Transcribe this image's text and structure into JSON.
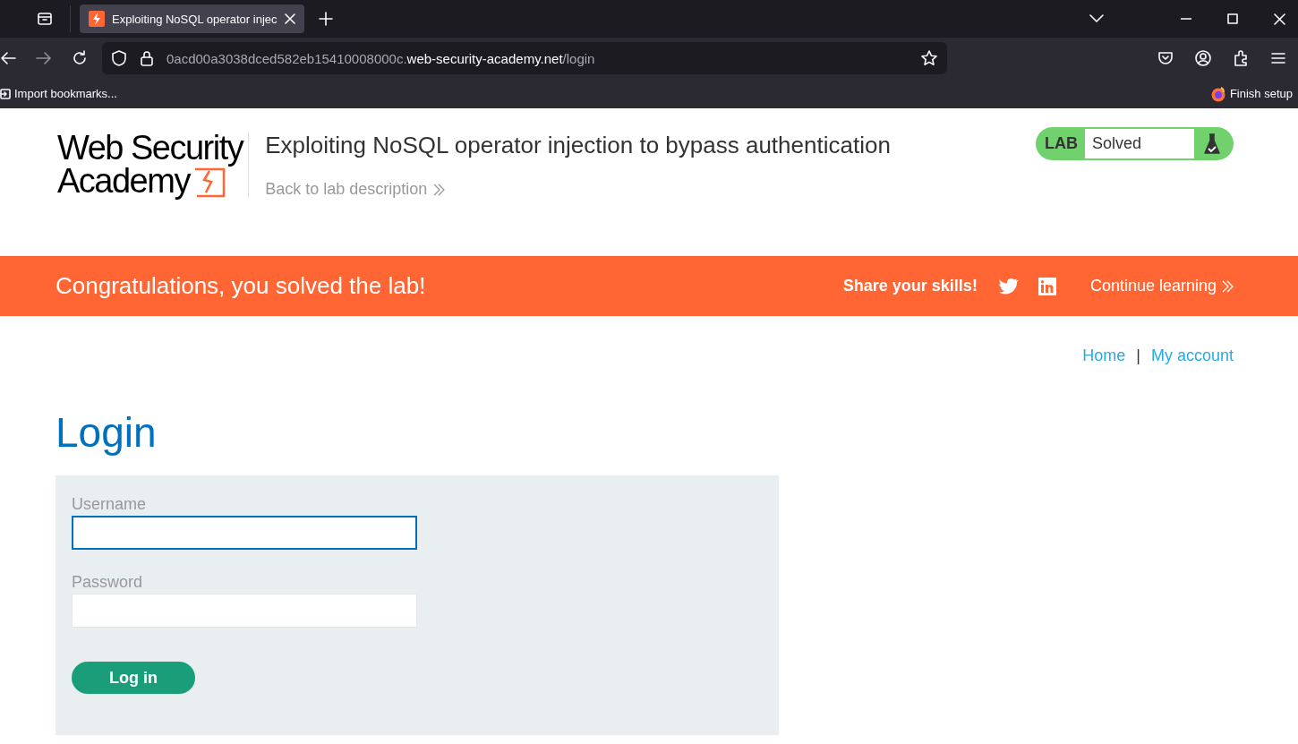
{
  "browser": {
    "tab": {
      "title": "Exploiting NoSQL operator injec",
      "selected": true
    },
    "url": {
      "prefix": "0acd00a3038dced582eb15410008000c.",
      "domain": "web-security-academy.net",
      "path": "/login"
    },
    "bookmarks": [
      {
        "label": "Import bookmarks..."
      }
    ],
    "finish_setup": "Finish setup"
  },
  "header": {
    "logo_lines": [
      "Web Security",
      "Academy"
    ],
    "title": "Exploiting NoSQL operator injection to bypass authentication",
    "back_link": "Back to lab description",
    "lab_badge": {
      "label": "LAB",
      "status": "Solved",
      "solved": true
    }
  },
  "banner": {
    "message": "Congratulations, you solved the lab!",
    "share": "Share your skills!",
    "continue": "Continue learning"
  },
  "nav": {
    "links": [
      "Home",
      "My account"
    ],
    "separator": "|"
  },
  "login": {
    "heading": "Login",
    "fields": [
      {
        "label": "Username",
        "focused": true
      },
      {
        "label": "Password",
        "focused": false
      }
    ],
    "button": "Log in"
  }
}
